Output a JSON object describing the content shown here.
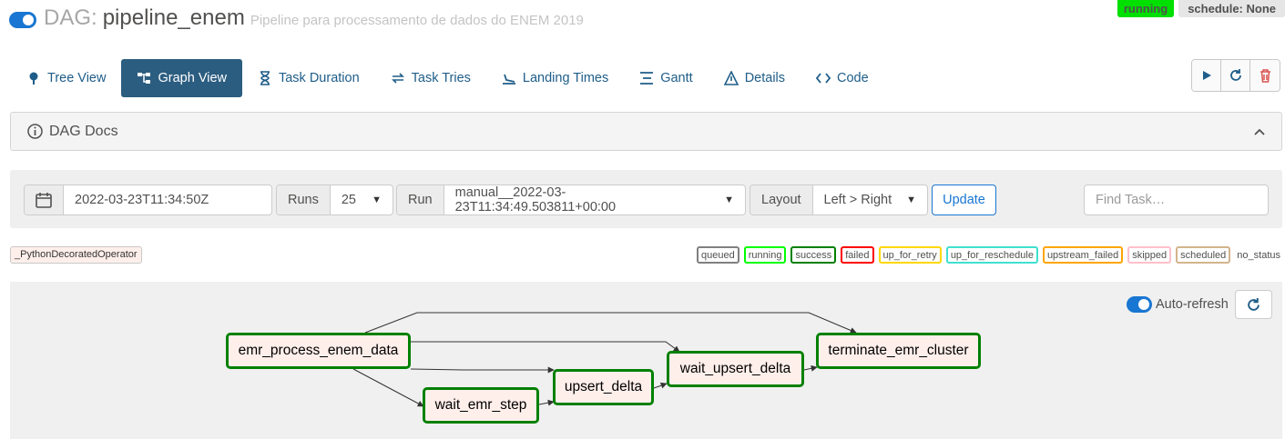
{
  "header": {
    "dag_prefix": "DAG:",
    "dag_id": "pipeline_enem",
    "description": "Pipeline para processamento de dados do ENEM 2019",
    "state_badge": "running",
    "schedule_badge": "schedule: None"
  },
  "nav": {
    "tabs": [
      {
        "label": "Tree View",
        "icon": "tree-icon"
      },
      {
        "label": "Graph View",
        "icon": "graph-icon"
      },
      {
        "label": "Task Duration",
        "icon": "hourglass-icon"
      },
      {
        "label": "Task Tries",
        "icon": "retry-icon"
      },
      {
        "label": "Landing Times",
        "icon": "landing-icon"
      },
      {
        "label": "Gantt",
        "icon": "gantt-icon"
      },
      {
        "label": "Details",
        "icon": "warning-icon"
      },
      {
        "label": "Code",
        "icon": "code-icon"
      }
    ],
    "active_tab": "Graph View",
    "actions": [
      "play-icon",
      "refresh-icon",
      "trash-icon"
    ]
  },
  "docs": {
    "label": "DAG Docs"
  },
  "form": {
    "execution_date": "2022-03-23T11:34:50Z",
    "runs_label": "Runs",
    "runs_value": "25",
    "run_label": "Run",
    "run_value": "manual__2022-03-23T11:34:49.503811+00:00",
    "layout_label": "Layout",
    "layout_value": "Left > Right",
    "update_label": "Update",
    "find_placeholder": "Find Task…"
  },
  "legend": {
    "operator": "_PythonDecoratedOperator",
    "states": [
      {
        "label": "queued",
        "color": "#808080"
      },
      {
        "label": "running",
        "color": "#00ff00"
      },
      {
        "label": "success",
        "color": "#008000"
      },
      {
        "label": "failed",
        "color": "#ff0000"
      },
      {
        "label": "up_for_retry",
        "color": "#ffd700"
      },
      {
        "label": "up_for_reschedule",
        "color": "#40e0d0"
      },
      {
        "label": "upstream_failed",
        "color": "#ffa500"
      },
      {
        "label": "skipped",
        "color": "#ffc0cb"
      },
      {
        "label": "scheduled",
        "color": "#d2b48c"
      }
    ],
    "no_status": "no_status"
  },
  "graph": {
    "auto_refresh_label": "Auto-refresh",
    "node_state_color": "#008000",
    "node_fill_color": "#ffefeb",
    "tasks": [
      {
        "id": "emr_process_enem_data",
        "state": "success"
      },
      {
        "id": "wait_emr_step",
        "state": "success"
      },
      {
        "id": "upsert_delta",
        "state": "success"
      },
      {
        "id": "wait_upsert_delta",
        "state": "success"
      },
      {
        "id": "terminate_emr_cluster",
        "state": "success"
      }
    ],
    "edges": [
      [
        "emr_process_enem_data",
        "wait_emr_step"
      ],
      [
        "emr_process_enem_data",
        "upsert_delta"
      ],
      [
        "emr_process_enem_data",
        "wait_upsert_delta"
      ],
      [
        "emr_process_enem_data",
        "terminate_emr_cluster"
      ],
      [
        "wait_emr_step",
        "upsert_delta"
      ],
      [
        "upsert_delta",
        "wait_upsert_delta"
      ],
      [
        "wait_upsert_delta",
        "terminate_emr_cluster"
      ]
    ]
  }
}
